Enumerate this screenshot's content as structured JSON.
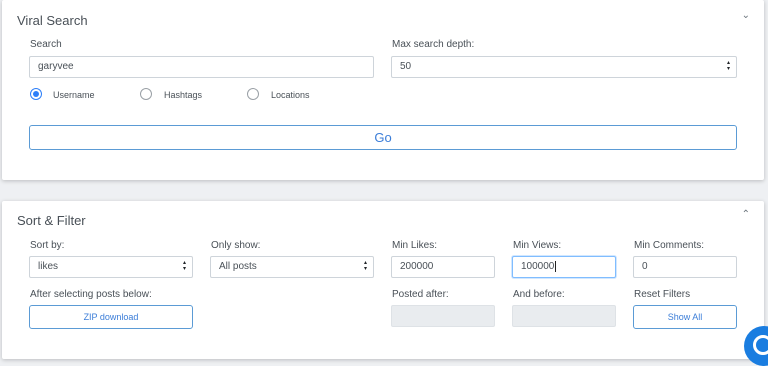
{
  "viral_search": {
    "title": "Viral Search",
    "toggle_icon": "chevron-down-icon",
    "search_label": "Search",
    "search_value": "garyvee",
    "depth_label": "Max search depth:",
    "depth_value": "50",
    "options": [
      {
        "label": "Username",
        "checked": true
      },
      {
        "label": "Hashtags",
        "checked": false
      },
      {
        "label": "Locations",
        "checked": false
      }
    ],
    "go_label": "Go"
  },
  "sort_filter": {
    "title": "Sort & Filter",
    "toggle_icon": "chevron-up-icon",
    "sort_label": "Sort by:",
    "sort_value": "likes",
    "only_label": "Only show:",
    "only_value": "All posts",
    "min_likes_label": "Min Likes:",
    "min_likes_value": "200000",
    "min_views_label": "Min Views:",
    "min_views_value": "100000",
    "min_comments_label": "Min Comments:",
    "min_comments_value": "0",
    "after_label": "After selecting posts below:",
    "zip_label": "ZIP download",
    "posted_after_label": "Posted after:",
    "before_label": "And before:",
    "reset_label": "Reset Filters",
    "show_all_label": "Show All"
  },
  "chat_widget_icon": "chat-bubble-icon",
  "colors": {
    "accent": "#3b7dd8",
    "radio": "#2d7ff9",
    "chat": "#1a7de0"
  }
}
